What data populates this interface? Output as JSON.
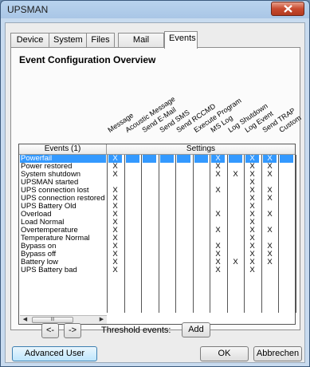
{
  "window": {
    "title": "UPSMAN"
  },
  "tabs": [
    {
      "label": "Device",
      "active": false
    },
    {
      "label": "System",
      "active": false
    },
    {
      "label": "Files",
      "active": false
    },
    {
      "label": "Mail Server",
      "active": false
    },
    {
      "label": "Events",
      "active": true
    }
  ],
  "overview_title": "Event Configuration Overview",
  "columns": [
    "Message",
    "Acoustic Message",
    "Send E-Mail",
    "Send SMS",
    "Send RCCMD",
    "Execute Program",
    "MS Log",
    "Log Shutdown",
    "Log Event",
    "Send TRAP",
    "Custom"
  ],
  "grid": {
    "events_header": "Events (1)",
    "settings_header": "Settings",
    "rows": [
      {
        "event": "Powerfail",
        "selected": true,
        "marks": [
          "X",
          "",
          "",
          "",
          "",
          "",
          "X",
          "",
          "X",
          "X",
          ""
        ]
      },
      {
        "event": "Power restored",
        "marks": [
          "X",
          "",
          "",
          "",
          "",
          "",
          "X",
          "",
          "X",
          "X",
          ""
        ]
      },
      {
        "event": "System shutdown",
        "marks": [
          "X",
          "",
          "",
          "",
          "",
          "",
          "X",
          "X",
          "X",
          "X",
          ""
        ]
      },
      {
        "event": "UPSMAN started",
        "marks": [
          "",
          "",
          "",
          "",
          "",
          "",
          "",
          "",
          "X",
          "",
          ""
        ]
      },
      {
        "event": "UPS connection lost",
        "marks": [
          "X",
          "",
          "",
          "",
          "",
          "",
          "X",
          "",
          "X",
          "X",
          ""
        ]
      },
      {
        "event": "UPS connection restored",
        "marks": [
          "X",
          "",
          "",
          "",
          "",
          "",
          "",
          "",
          "X",
          "X",
          ""
        ]
      },
      {
        "event": "UPS Battery Old",
        "marks": [
          "X",
          "",
          "",
          "",
          "",
          "",
          "",
          "",
          "X",
          "",
          ""
        ]
      },
      {
        "event": "Overload",
        "marks": [
          "X",
          "",
          "",
          "",
          "",
          "",
          "X",
          "",
          "X",
          "X",
          ""
        ]
      },
      {
        "event": "Load Normal",
        "marks": [
          "X",
          "",
          "",
          "",
          "",
          "",
          "",
          "",
          "X",
          "",
          ""
        ]
      },
      {
        "event": "Overtemperature",
        "marks": [
          "X",
          "",
          "",
          "",
          "",
          "",
          "X",
          "",
          "X",
          "X",
          ""
        ]
      },
      {
        "event": "Temperature Normal",
        "marks": [
          "X",
          "",
          "",
          "",
          "",
          "",
          "",
          "",
          "X",
          "",
          ""
        ]
      },
      {
        "event": "Bypass on",
        "marks": [
          "X",
          "",
          "",
          "",
          "",
          "",
          "X",
          "",
          "X",
          "X",
          ""
        ]
      },
      {
        "event": "Bypass off",
        "marks": [
          "X",
          "",
          "",
          "",
          "",
          "",
          "X",
          "",
          "X",
          "X",
          ""
        ]
      },
      {
        "event": "Battery low",
        "marks": [
          "X",
          "",
          "",
          "",
          "",
          "",
          "X",
          "X",
          "X",
          "X",
          ""
        ]
      },
      {
        "event": "UPS Battery bad",
        "marks": [
          "X",
          "",
          "",
          "",
          "",
          "",
          "X",
          "",
          "X",
          "",
          ""
        ]
      }
    ],
    "scroll_thumb_glyph": "III"
  },
  "nav": {
    "prev_label": "<-",
    "next_label": "->"
  },
  "threshold": {
    "label": "Threshold events:",
    "add_label": "Add"
  },
  "footer": {
    "advanced_label": "Advanced User",
    "ok_label": "OK",
    "cancel_label": "Abbrechen"
  }
}
